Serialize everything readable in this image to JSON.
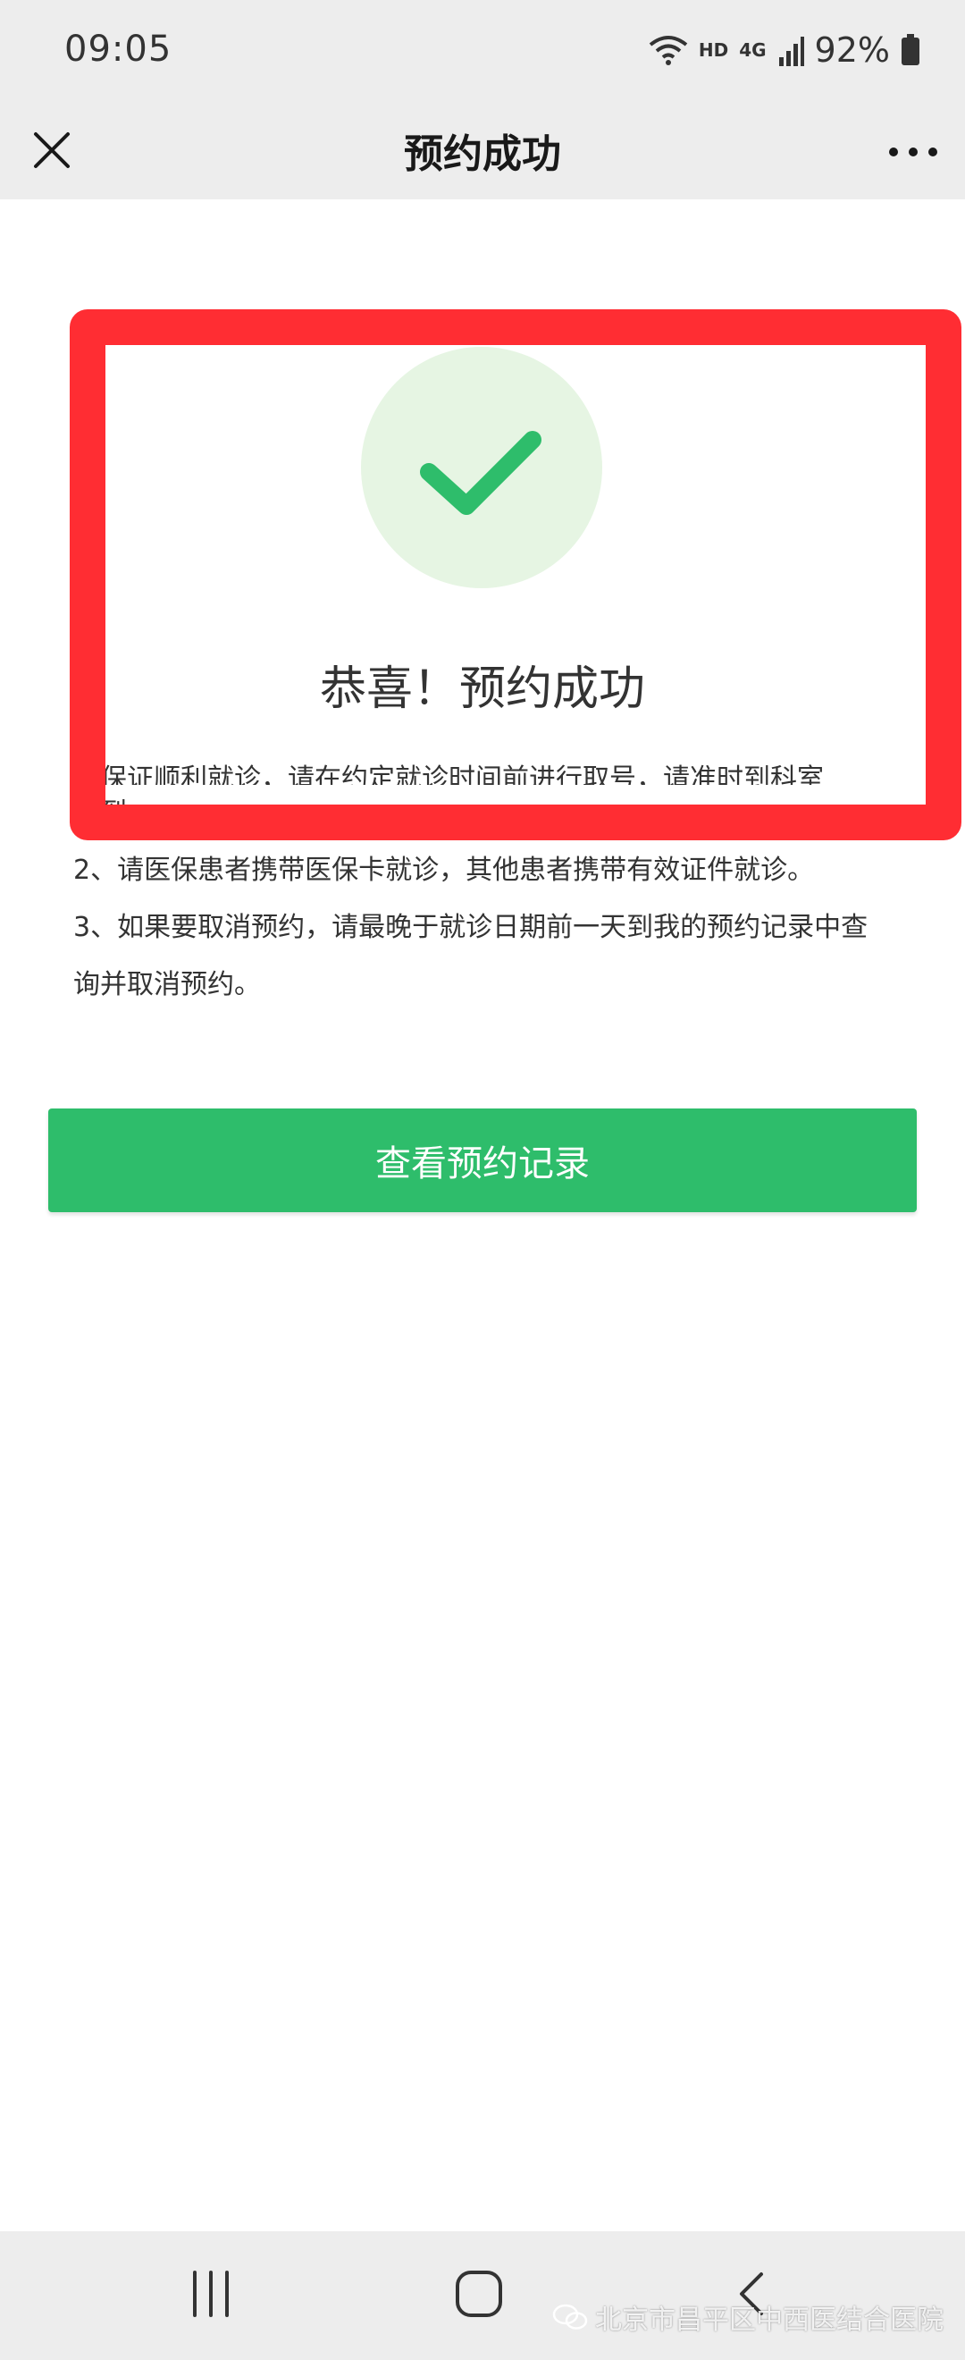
{
  "status_bar": {
    "time": "09:05",
    "hd": "HD",
    "network": "4G",
    "battery": "92%"
  },
  "header": {
    "title": "预约成功"
  },
  "success": {
    "title": "恭喜！预约成功"
  },
  "notes": {
    "line1": "为保证顺利就诊，请在约定就诊时间前进行取号，请准时到科室",
    "line1_cont": "签到。",
    "line2": "2、请医保患者携带医保卡就诊，其他患者携带有效证件就诊。",
    "line3": "3、如果要取消预约，请最晚于就诊日期前一天到我的预约记录中查",
    "line3_cont": "询并取消预约。"
  },
  "actions": {
    "view_records_label": "查看预约记录"
  },
  "watermark": {
    "text": "北京市昌平区中西医结合医院"
  },
  "colors": {
    "accent_green": "#2ebd6b",
    "highlight_red": "#ff2d33",
    "check_bg": "#e6f5e3"
  },
  "icons": {
    "close": "close-icon",
    "more": "more-icon",
    "check": "check-icon",
    "wifi": "wifi-icon",
    "signal": "signal-icon",
    "battery": "battery-icon"
  }
}
